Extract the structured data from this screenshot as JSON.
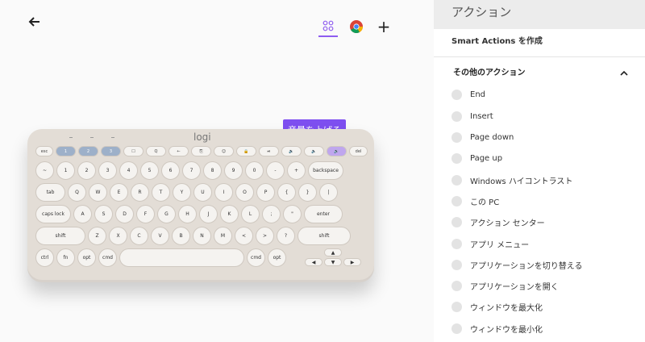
{
  "tooltip": "音量を上げる",
  "keyboard": {
    "logo": "logi",
    "frow": [
      "esc",
      "1",
      "2",
      "3",
      "☐",
      "Q",
      "←",
      "⎘",
      "☺",
      "🔒",
      "⏯",
      "🔉",
      "🔈",
      "🔊",
      "del"
    ],
    "row1": [
      "~",
      "1",
      "2",
      "3",
      "4",
      "5",
      "6",
      "7",
      "8",
      "9",
      "0",
      "-",
      "+",
      "backspace"
    ],
    "row2": [
      "tab",
      "Q",
      "W",
      "E",
      "R",
      "T",
      "Y",
      "U",
      "I",
      "O",
      "P",
      "{",
      "}",
      "|"
    ],
    "row3": [
      "caps lock",
      "A",
      "S",
      "D",
      "F",
      "G",
      "H",
      "J",
      "K",
      "L",
      ";",
      "\"",
      "enter"
    ],
    "row4": [
      "shift",
      "Z",
      "X",
      "C",
      "V",
      "B",
      "N",
      "M",
      "<",
      ">",
      "?",
      "shift"
    ],
    "row5": [
      "ctrl",
      "fn",
      "opt",
      "cmd",
      "",
      "cmd",
      "opt"
    ]
  },
  "panel": {
    "title": "アクション",
    "create_label": "Smart Actions を作成",
    "section_label": "その他のアクション",
    "actions": [
      "End",
      "Insert",
      "Page down",
      "Page up",
      "Windows ハイコントラスト",
      "この PC",
      "アクション センター",
      "アプリ メニュー",
      "アプリケーションを切り替える",
      "アプリケーションを開く",
      "ウィンドウを最大化",
      "ウィンドウを最小化"
    ]
  },
  "colors": {
    "accent": "#7e4ff0",
    "keyboard_body": "#e3ddd6",
    "fkey_blue": "#9db0c9"
  }
}
